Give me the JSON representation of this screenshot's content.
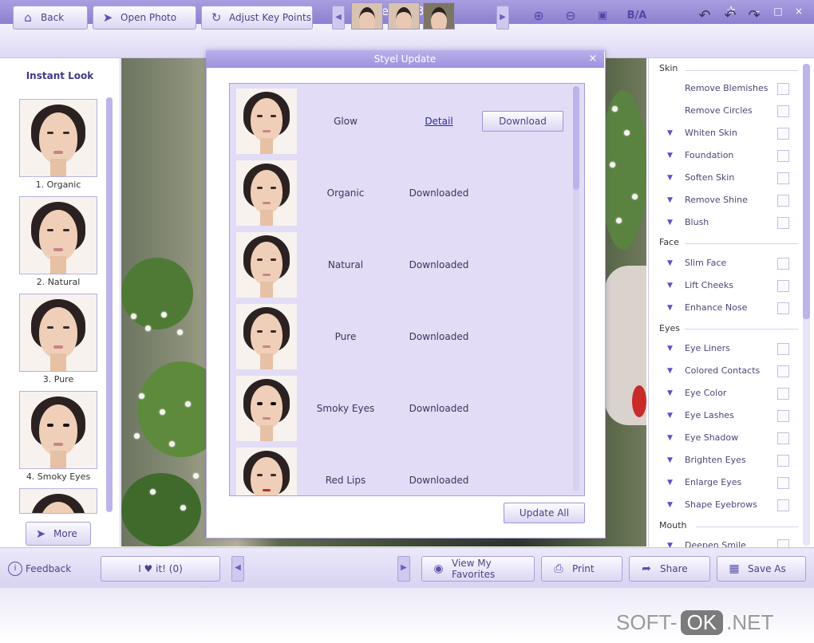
{
  "app": {
    "title": "Perfect365",
    "badge": "·"
  },
  "window_controls": [
    "–",
    "□",
    "×"
  ],
  "toolbar": {
    "back_label": "Back",
    "open_photo_label": "Open Photo",
    "adjust_label": "Adjust Key Points",
    "compare_label": "B/A"
  },
  "left_panel": {
    "title": "Instant Look",
    "looks": [
      "1. Organic",
      "2. Natural",
      "3. Pure",
      "4. Smoky Eyes"
    ],
    "more_label": "More"
  },
  "dialog": {
    "title": "Styel Update",
    "rows": [
      {
        "name": "Glow",
        "status": "Detail",
        "action": "Download"
      },
      {
        "name": "Organic",
        "status": "Downloaded"
      },
      {
        "name": "Natural",
        "status": "Downloaded"
      },
      {
        "name": "Pure",
        "status": "Downloaded"
      },
      {
        "name": "Smoky Eyes",
        "status": "Downloaded"
      },
      {
        "name": "Red Lips",
        "status": "Downloaded"
      }
    ],
    "update_all_label": "Update All"
  },
  "right_panel": {
    "skin_header": "Skin",
    "skin": [
      "Remove Blemishes",
      "Remove Circles",
      "Whiten Skin",
      "Foundation",
      "Soften Skin",
      "Remove Shine",
      "Blush"
    ],
    "face_header": "Face",
    "face": [
      "Slim Face",
      "Lift Cheeks",
      "Enhance Nose"
    ],
    "eyes_header": "Eyes",
    "eyes": [
      "Eye Liners",
      "Colored Contacts",
      "Eye Color",
      "Eye Lashes",
      "Eye Shadow",
      "Brighten Eyes",
      "Enlarge Eyes",
      "Shape Eyebrows"
    ],
    "mouth_header": "Mouth",
    "mouth": [
      "Deepen Smile"
    ]
  },
  "bottom": {
    "feedback_label": "Feedback",
    "rating_label": "I ♥ it! (0)",
    "favorites_label": "View My Favorites",
    "print_label": "Print",
    "share_label": "Share",
    "save_as_label": "Save As"
  },
  "watermark": {
    "left": "SOFT-",
    "box": "OK",
    "right": ".NET"
  },
  "colors": {
    "accent": "#8c80cf",
    "panel": "#e2dcf6",
    "link": "#2c2a9a"
  }
}
